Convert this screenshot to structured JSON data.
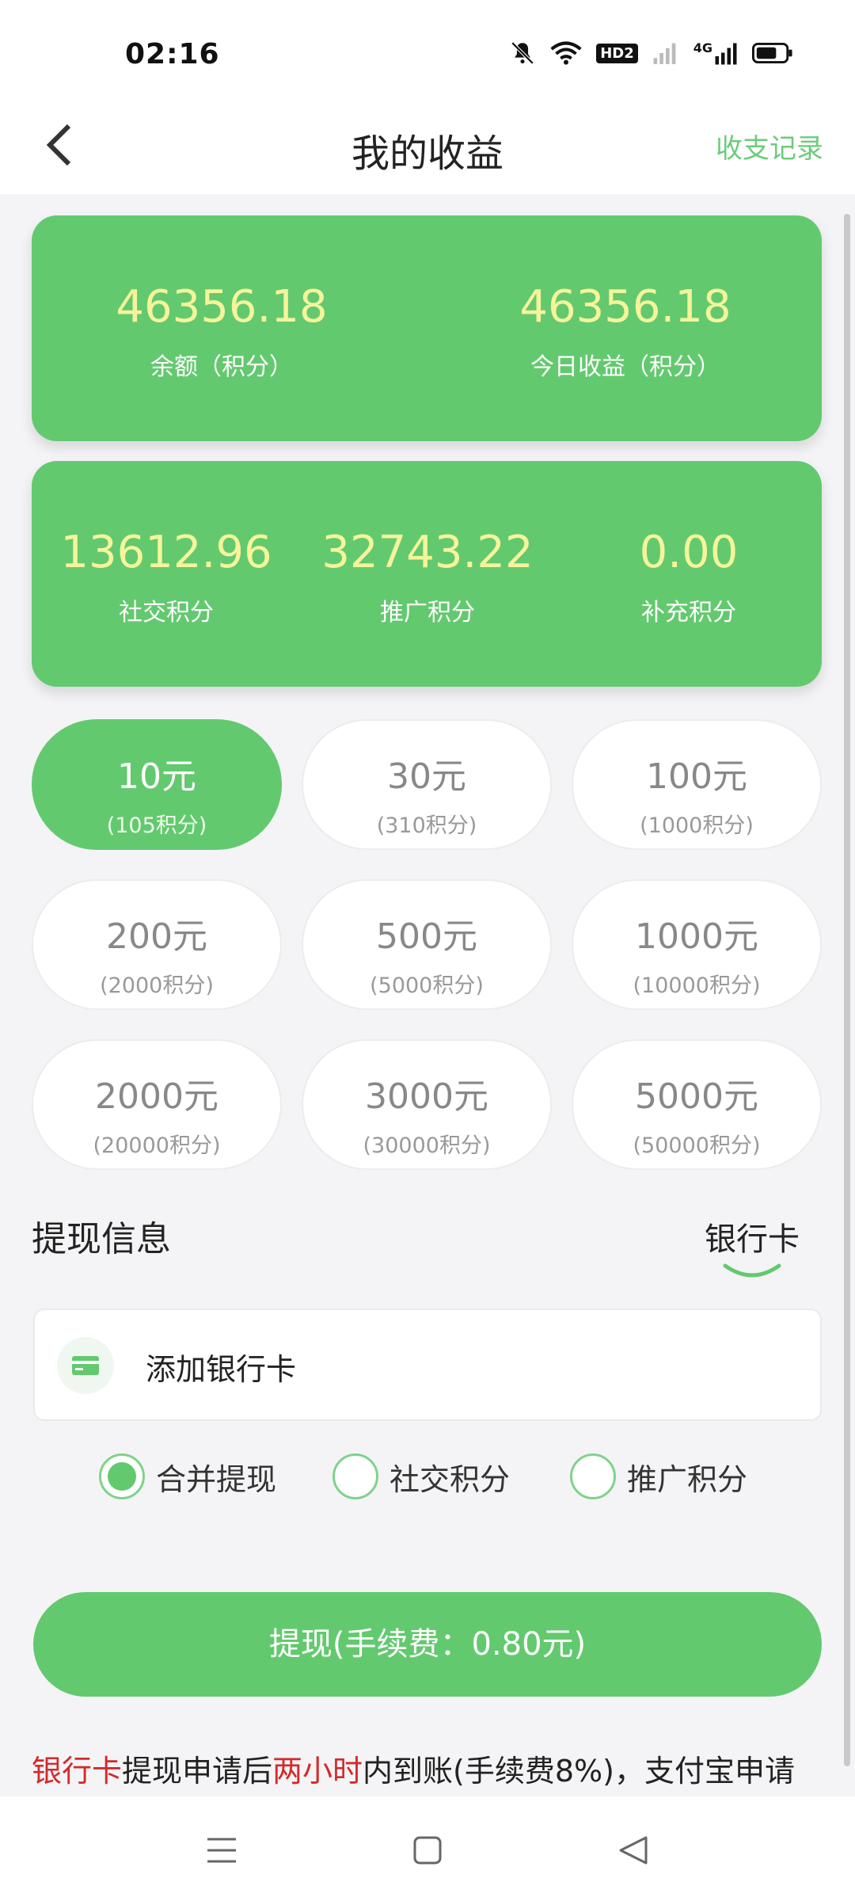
{
  "status_bar": {
    "time": "02:16",
    "icons": [
      "mute-bell-icon",
      "wifi-icon",
      "hd2-icon",
      "signal-off-icon",
      "4g-signal-icon",
      "battery-icon"
    ],
    "hd_label": "HD2",
    "network_label": "4G"
  },
  "nav": {
    "back_icon": "chevron-left-icon",
    "title": "我的收益",
    "right_link": "收支记录"
  },
  "summary_card": {
    "balance_value": "46356.18",
    "balance_label": "余额（积分）",
    "today_value": "46356.18",
    "today_label": "今日收益（积分）"
  },
  "points_card": {
    "social_value": "13612.96",
    "social_label": "社交积分",
    "promo_value": "32743.22",
    "promo_label": "推广积分",
    "extra_value": "0.00",
    "extra_label": "补充积分"
  },
  "amount_options": [
    {
      "amount": "10元",
      "points": "(105积分)",
      "selected": true
    },
    {
      "amount": "30元",
      "points": "(310积分)",
      "selected": false
    },
    {
      "amount": "100元",
      "points": "(1000积分)",
      "selected": false
    },
    {
      "amount": "200元",
      "points": "(2000积分)",
      "selected": false
    },
    {
      "amount": "500元",
      "points": "(5000积分)",
      "selected": false
    },
    {
      "amount": "1000元",
      "points": "(10000积分)",
      "selected": false
    },
    {
      "amount": "2000元",
      "points": "(20000积分)",
      "selected": false
    },
    {
      "amount": "3000元",
      "points": "(30000积分)",
      "selected": false
    },
    {
      "amount": "5000元",
      "points": "(50000积分)",
      "selected": false
    }
  ],
  "withdraw_info": {
    "title": "提现信息",
    "method_tab": "银行卡",
    "add_card_icon": "bank-card-icon",
    "add_card_label": "添加银行卡"
  },
  "withdraw_sources": [
    {
      "label": "合并提现",
      "checked": true
    },
    {
      "label": "社交积分",
      "checked": false
    },
    {
      "label": "推广积分",
      "checked": false
    }
  ],
  "withdraw_button": "提现(手续费：0.80元)",
  "notice": {
    "part1": "银行卡",
    "part2": "提现申请后",
    "part3": "两小时",
    "part4": "内到账(手续费8%)，支付宝申请"
  },
  "system_nav": {
    "menu_icon": "menu-icon",
    "home_icon": "home-square-icon",
    "back_icon": "back-triangle-icon"
  },
  "colors": {
    "primary_green": "#63c96f",
    "value_yellow": "#f6f49a",
    "link_green": "#6ccc7a",
    "notice_red": "#d32a2a"
  }
}
